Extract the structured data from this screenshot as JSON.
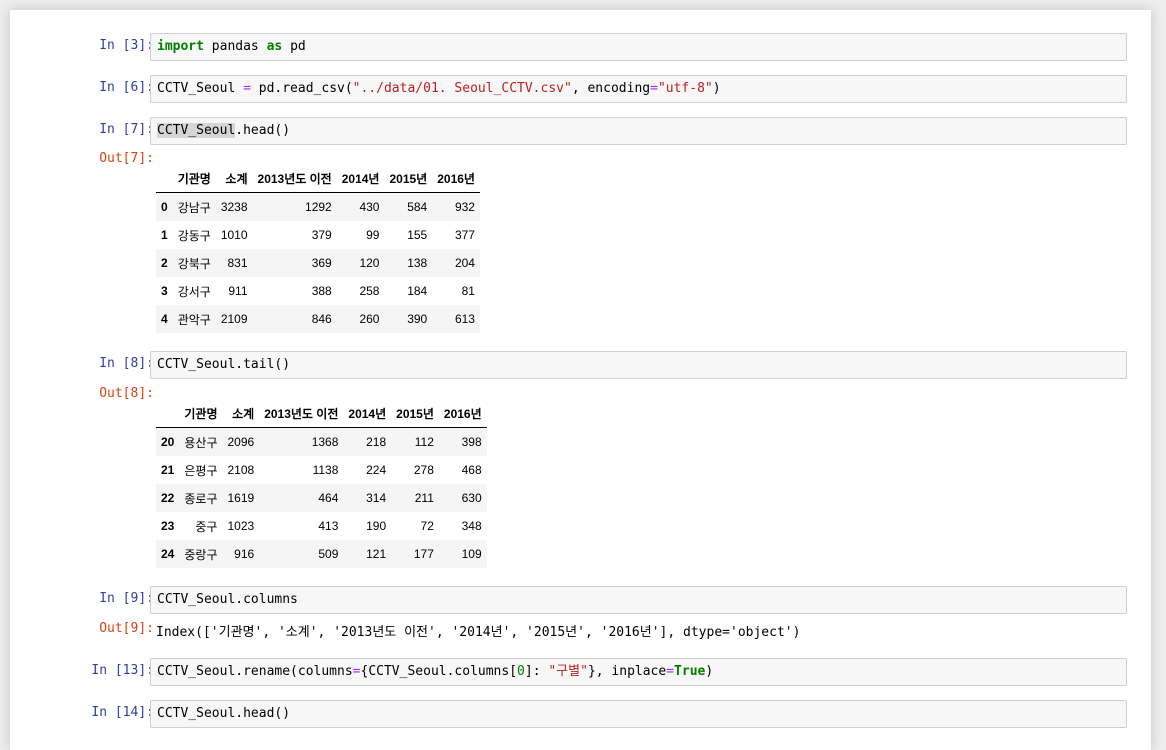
{
  "cells": {
    "c3": {
      "prompt": "In [3]:",
      "kw1": "import",
      "mod": " pandas ",
      "kw2": "as",
      "alias": " pd"
    },
    "c6": {
      "prompt": "In [6]:",
      "var": "CCTV_Seoul ",
      "eq": "=",
      "call": " pd.read_csv(",
      "path": "\"../data/01. Seoul_CCTV.csv\"",
      "comma": ", encoding",
      "eq2": "=",
      "enc": "\"utf-8\"",
      "close": ")"
    },
    "c7": {
      "prompt": "In [7]:",
      "var": "CCTV_Seoul",
      "rest": ".head()"
    },
    "o7": {
      "prompt": "Out[7]:"
    },
    "c8": {
      "prompt": "In [8]:",
      "code": "CCTV_Seoul.tail()"
    },
    "o8": {
      "prompt": "Out[8]:"
    },
    "c9": {
      "prompt": "In [9]:",
      "code": "CCTV_Seoul.columns"
    },
    "o9": {
      "prompt": "Out[9]:",
      "text": "Index(['기관명', '소계', '2013년도 이전', '2014년', '2015년', '2016년'], dtype='object')"
    },
    "c13": {
      "prompt": "In [13]:",
      "a": "CCTV_Seoul.rename(columns",
      "eq": "=",
      "b": "{CCTV_Seoul.columns[",
      "n": "0",
      "c": "]: ",
      "s": "\"구별\"",
      "d": "}, inplace",
      "eq2": "=",
      "t": "True",
      "e": ")"
    },
    "c14": {
      "prompt": "In [14]:",
      "code": "CCTV_Seoul.head()"
    }
  },
  "columns": [
    "기관명",
    "소계",
    "2013년도 이전",
    "2014년",
    "2015년",
    "2016년"
  ],
  "head_rows": [
    [
      "0",
      "강남구",
      "3238",
      "1292",
      "430",
      "584",
      "932"
    ],
    [
      "1",
      "강동구",
      "1010",
      "379",
      "99",
      "155",
      "377"
    ],
    [
      "2",
      "강북구",
      "831",
      "369",
      "120",
      "138",
      "204"
    ],
    [
      "3",
      "강서구",
      "911",
      "388",
      "258",
      "184",
      "81"
    ],
    [
      "4",
      "관악구",
      "2109",
      "846",
      "260",
      "390",
      "613"
    ]
  ],
  "tail_rows": [
    [
      "20",
      "용산구",
      "2096",
      "1368",
      "218",
      "112",
      "398"
    ],
    [
      "21",
      "은평구",
      "2108",
      "1138",
      "224",
      "278",
      "468"
    ],
    [
      "22",
      "종로구",
      "1619",
      "464",
      "314",
      "211",
      "630"
    ],
    [
      "23",
      "중구",
      "1023",
      "413",
      "190",
      "72",
      "348"
    ],
    [
      "24",
      "중랑구",
      "916",
      "509",
      "121",
      "177",
      "109"
    ]
  ]
}
